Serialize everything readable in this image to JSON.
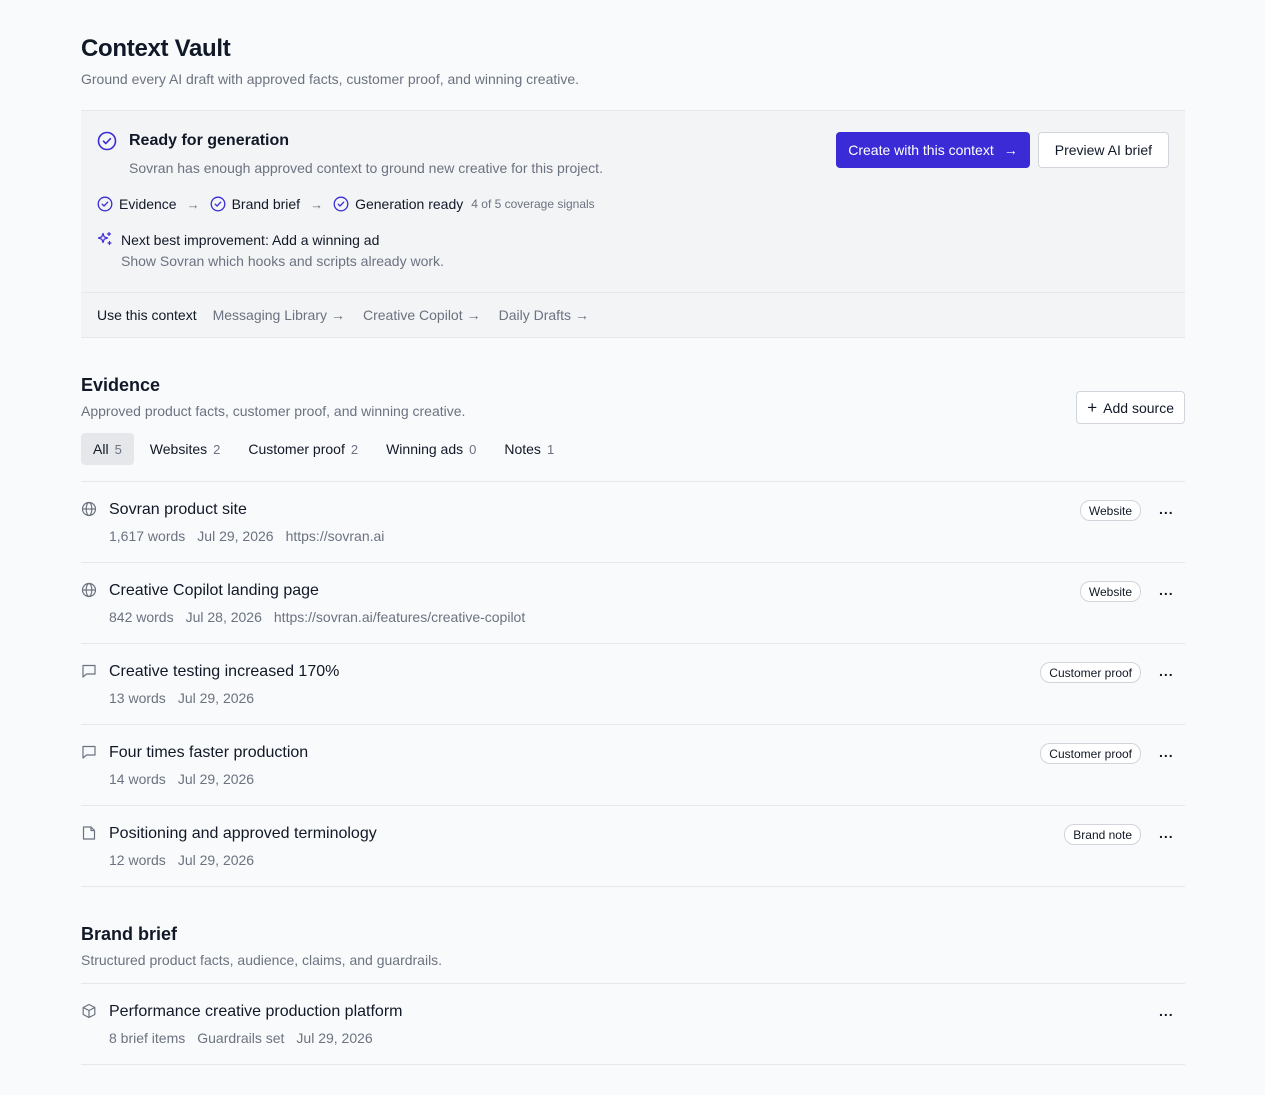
{
  "page": {
    "title": "Context Vault",
    "subtitle": "Ground every AI draft with approved facts, customer proof, and winning creative."
  },
  "status": {
    "title": "Ready for generation",
    "description": "Sovran has enough approved context to ground new creative for this project.",
    "pipeline": [
      "Evidence",
      "Brand brief",
      "Generation ready"
    ],
    "coverage": "4 of 5 coverage signals",
    "improvement_title": "Next best improvement: Add a winning ad",
    "improvement_desc": "Show Sovran which hooks and scripts already work.",
    "primary_button": "Create with this context",
    "secondary_button": "Preview AI brief"
  },
  "use_context": {
    "label": "Use this context",
    "links": [
      "Messaging Library",
      "Creative Copilot",
      "Daily Drafts"
    ]
  },
  "evidence": {
    "title": "Evidence",
    "subtitle": "Approved product facts, customer proof, and winning creative.",
    "add_button": "Add source",
    "tabs": [
      {
        "label": "All",
        "count": "5"
      },
      {
        "label": "Websites",
        "count": "2"
      },
      {
        "label": "Customer proof",
        "count": "2"
      },
      {
        "label": "Winning ads",
        "count": "0"
      },
      {
        "label": "Notes",
        "count": "1"
      }
    ],
    "items": [
      {
        "icon": "globe-icon",
        "title": "Sovran product site",
        "meta": [
          "1,617 words",
          "Jul 29, 2026",
          "https://sovran.ai"
        ],
        "badge": "Website"
      },
      {
        "icon": "globe-icon",
        "title": "Creative Copilot landing page",
        "meta": [
          "842 words",
          "Jul 28, 2026",
          "https://sovran.ai/features/creative-copilot"
        ],
        "badge": "Website"
      },
      {
        "icon": "message-icon",
        "title": "Creative testing increased 170%",
        "meta": [
          "13 words",
          "Jul 29, 2026"
        ],
        "badge": "Customer proof"
      },
      {
        "icon": "message-icon",
        "title": "Four times faster production",
        "meta": [
          "14 words",
          "Jul 29, 2026"
        ],
        "badge": "Customer proof"
      },
      {
        "icon": "note-icon",
        "title": "Positioning and approved terminology",
        "meta": [
          "12 words",
          "Jul 29, 2026"
        ],
        "badge": "Brand note"
      }
    ]
  },
  "brief": {
    "title": "Brand brief",
    "subtitle": "Structured product facts, audience, claims, and guardrails.",
    "item": {
      "icon": "box-icon",
      "title": "Performance creative production platform",
      "meta": [
        "8 brief items",
        "Guardrails set",
        "Jul 29, 2026"
      ]
    }
  },
  "more_label": "...",
  "colors": {
    "accent": "#3b2bd6",
    "muted": "#6b7280",
    "border": "#e5e7eb"
  }
}
